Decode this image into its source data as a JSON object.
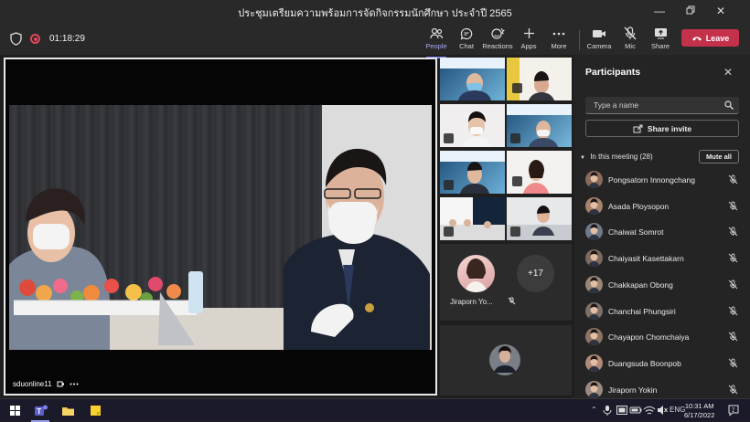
{
  "window": {
    "title": "ประชุมเตรียมความพร้อมการจัดกิจกรรมนักศึกษา ประจำปี 2565"
  },
  "toolbar": {
    "timer": "01:18:29",
    "buttons": [
      {
        "id": "people",
        "label": "People",
        "icon": "people-icon"
      },
      {
        "id": "chat",
        "label": "Chat",
        "icon": "chat-icon"
      },
      {
        "id": "reactions",
        "label": "Reactions",
        "icon": "reactions-icon"
      },
      {
        "id": "apps",
        "label": "Apps",
        "icon": "plus-icon"
      },
      {
        "id": "more",
        "label": "More",
        "icon": "ellipsis-icon"
      },
      {
        "id": "camera",
        "label": "Camera",
        "icon": "camera-icon"
      },
      {
        "id": "mic",
        "label": "Mic",
        "icon": "mic-off-icon"
      },
      {
        "id": "share",
        "label": "Share",
        "icon": "share-screen-icon"
      }
    ],
    "leave_label": "Leave"
  },
  "main_video": {
    "participant": "sduonline11"
  },
  "grid": {
    "featured_name": "Jiraporn Yo...",
    "overflow_count": "+17"
  },
  "panel": {
    "title": "Participants",
    "search_placeholder": "Type a name",
    "share_invite_label": "Share invite",
    "in_meeting_label": "In this meeting (28)",
    "mute_all_label": "Mute all",
    "participants": [
      {
        "name": "Pongsatorn Innongchang"
      },
      {
        "name": "Asada Ploysopon"
      },
      {
        "name": "Chaiwat Somrot"
      },
      {
        "name": "Chaiyasit Kasettakarn"
      },
      {
        "name": "Chakkapan Obong"
      },
      {
        "name": "Chanchai Phungsiri"
      },
      {
        "name": "Chayapon Chomchaiya"
      },
      {
        "name": "Duangsuda Boonpob"
      },
      {
        "name": "Jiraporn Yokin"
      }
    ]
  },
  "taskbar": {
    "language": "ENG",
    "time": "10:31 AM",
    "date": "6/17/2022"
  },
  "colors": {
    "accent": "#7f85f5",
    "leave": "#c4314b",
    "background": "#1f1f1f"
  }
}
